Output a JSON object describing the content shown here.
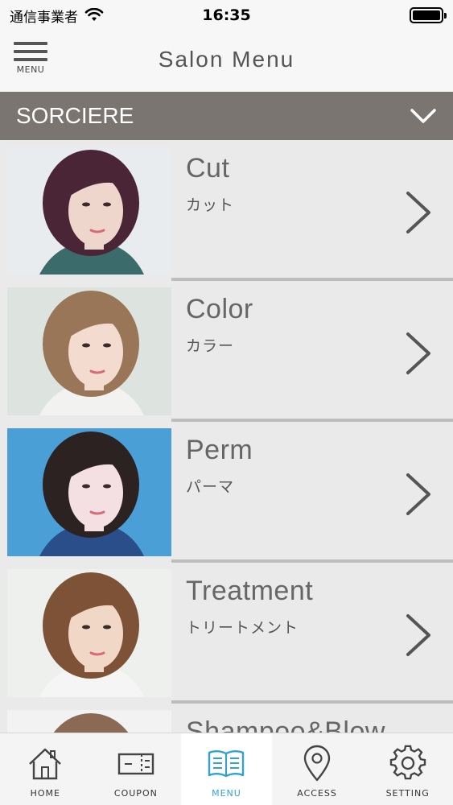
{
  "status_bar": {
    "carrier": "通信事業者",
    "time": "16:35"
  },
  "header": {
    "menu_label": "MENU",
    "title": "Salon Menu"
  },
  "salon_selector": {
    "name": "SORCIERE"
  },
  "menu_items": [
    {
      "title": "Cut",
      "subtitle": "カット",
      "hair_color": "#4a2536",
      "bg_color": "#e9ecee",
      "skin": "#efd6cc",
      "shirt": "#3b6b6a"
    },
    {
      "title": "Color",
      "subtitle": "カラー",
      "hair_color": "#9a7658",
      "bg_color": "#dde4df",
      "skin": "#f3dccf",
      "shirt": "#f2f2f0"
    },
    {
      "title": "Perm",
      "subtitle": "パーマ",
      "hair_color": "#2c2222",
      "bg_color": "#4aa0d6",
      "skin": "#f4dfe2",
      "shirt": "#2a4e8a"
    },
    {
      "title": "Treatment",
      "subtitle": "トリートメント",
      "hair_color": "#7d5236",
      "bg_color": "#eef0ee",
      "skin": "#f1d7c6",
      "shirt": "#f5f5f5"
    },
    {
      "title": "Shampoo&Blow",
      "subtitle": "",
      "hair_color": "#8a6a55",
      "bg_color": "#f2f2f2",
      "skin": "#f1d7c6",
      "shirt": "#f5f5f5"
    }
  ],
  "tabs": [
    {
      "label": "HOME",
      "icon": "home-icon",
      "active": false
    },
    {
      "label": "COUPON",
      "icon": "coupon-icon",
      "active": false
    },
    {
      "label": "MENU",
      "icon": "book-icon",
      "active": true
    },
    {
      "label": "ACCESS",
      "icon": "map-pin-icon",
      "active": false
    },
    {
      "label": "SETTING",
      "icon": "gear-icon",
      "active": false
    }
  ],
  "colors": {
    "accent": "#2fa3d6",
    "salon_bar": "#7a7570",
    "list_bg": "#eaeaea"
  }
}
